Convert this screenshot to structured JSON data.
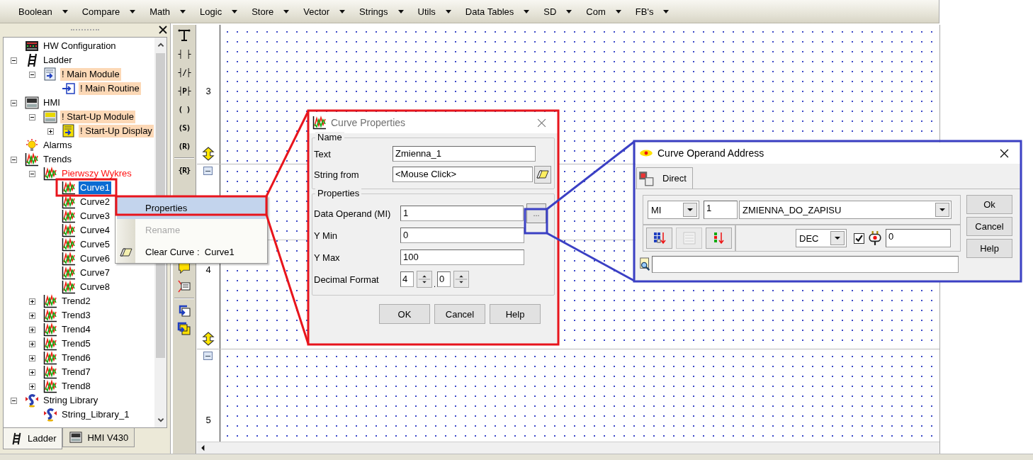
{
  "toolbar": {
    "menus": [
      {
        "label": "Boolean"
      },
      {
        "label": "Compare"
      },
      {
        "label": "Math"
      },
      {
        "label": "Logic"
      },
      {
        "label": "Store"
      },
      {
        "label": "Vector"
      },
      {
        "label": "Strings"
      },
      {
        "label": "Utils"
      },
      {
        "label": "Data Tables"
      },
      {
        "label": "SD"
      },
      {
        "label": "Com"
      },
      {
        "label": "FB's"
      }
    ]
  },
  "project_panel": {
    "tree": [
      {
        "label": "HW Configuration",
        "kind": "hw",
        "selected": false,
        "marked": false,
        "active": false
      },
      {
        "label": "Ladder",
        "kind": "ladder",
        "expanded": true,
        "selected": false,
        "marked": false,
        "active": false,
        "children": [
          {
            "label": "! Main Module",
            "kind": "module",
            "expanded": true,
            "selected": false,
            "marked": true,
            "active": false,
            "children": [
              {
                "label": "! Main Routine",
                "kind": "routine",
                "selected": false,
                "marked": true,
                "active": false
              }
            ]
          }
        ]
      },
      {
        "label": "HMI",
        "kind": "hmi",
        "expanded": true,
        "selected": false,
        "marked": false,
        "active": false,
        "children": [
          {
            "label": "! Start-Up Module",
            "kind": "hmi-module",
            "expanded": true,
            "selected": false,
            "marked": true,
            "active": false,
            "children": [
              {
                "label": "! Start-Up Display",
                "kind": "display",
                "expanded": false,
                "selected": false,
                "marked": true,
                "active": false
              }
            ]
          }
        ]
      },
      {
        "label": "Alarms",
        "kind": "alarm",
        "selected": false,
        "marked": false,
        "active": false
      },
      {
        "label": "Trends",
        "kind": "trend",
        "expanded": true,
        "selected": false,
        "marked": false,
        "active": false,
        "children": [
          {
            "label": "Pierwszy  Wykres",
            "kind": "trend",
            "expanded": true,
            "selected": false,
            "marked": false,
            "active": true,
            "children": [
              {
                "label": "Curve1",
                "kind": "trend",
                "selected": true,
                "marked": false,
                "active": false
              },
              {
                "label": "Curve2",
                "kind": "trend",
                "selected": false,
                "marked": false,
                "active": false
              },
              {
                "label": "Curve3",
                "kind": "trend",
                "selected": false,
                "marked": false,
                "active": false
              },
              {
                "label": "Curve4",
                "kind": "trend",
                "selected": false,
                "marked": false,
                "active": false
              },
              {
                "label": "Curve5",
                "kind": "trend",
                "selected": false,
                "marked": false,
                "active": false
              },
              {
                "label": "Curve6",
                "kind": "trend",
                "selected": false,
                "marked": false,
                "active": false
              },
              {
                "label": "Curve7",
                "kind": "trend",
                "selected": false,
                "marked": false,
                "active": false
              },
              {
                "label": "Curve8",
                "kind": "trend",
                "selected": false,
                "marked": false,
                "active": false
              }
            ]
          },
          {
            "label": "Trend2",
            "kind": "trend",
            "expanded": false,
            "selected": false,
            "marked": false,
            "active": false
          },
          {
            "label": "Trend3",
            "kind": "trend",
            "expanded": false,
            "selected": false,
            "marked": false,
            "active": false
          },
          {
            "label": "Trend4",
            "kind": "trend",
            "expanded": false,
            "selected": false,
            "marked": false,
            "active": false
          },
          {
            "label": "Trend5",
            "kind": "trend",
            "expanded": false,
            "selected": false,
            "marked": false,
            "active": false
          },
          {
            "label": "Trend6",
            "kind": "trend",
            "expanded": false,
            "selected": false,
            "marked": false,
            "active": false
          },
          {
            "label": "Trend7",
            "kind": "trend",
            "expanded": false,
            "selected": false,
            "marked": false,
            "active": false
          },
          {
            "label": "Trend8",
            "kind": "trend",
            "expanded": false,
            "selected": false,
            "marked": false,
            "active": false
          }
        ]
      },
      {
        "label": "String Library",
        "kind": "string",
        "expanded": true,
        "selected": false,
        "marked": false,
        "active": false,
        "children": [
          {
            "label": "String_Library_1",
            "kind": "string",
            "selected": false,
            "marked": false,
            "active": false
          }
        ]
      }
    ],
    "tabs": [
      {
        "label": "Ladder",
        "kind": "ladder",
        "selected": true
      },
      {
        "label": "HMI V430",
        "kind": "hmi",
        "selected": false
      }
    ]
  },
  "ladder_palette": [
    {
      "kind": "branch"
    },
    {
      "kind": "glyph",
      "label": "┤ ├"
    },
    {
      "kind": "glyph",
      "label": "┤/├"
    },
    {
      "kind": "glyph",
      "label": "┤P├"
    },
    {
      "kind": "glyph",
      "label": "( )"
    },
    {
      "kind": "glyph",
      "label": "(S)"
    },
    {
      "kind": "glyph",
      "label": "(R)"
    },
    {
      "kind": "separator"
    },
    {
      "kind": "glyph",
      "label": "{R}"
    },
    {
      "kind": "hidden"
    },
    {
      "kind": "comment"
    },
    {
      "kind": "list"
    },
    {
      "kind": "separator"
    },
    {
      "kind": "jump"
    },
    {
      "kind": "call"
    }
  ],
  "ladder": {
    "rungs": [
      {
        "number": "3"
      },
      {
        "number": "4"
      },
      {
        "number": "5"
      }
    ]
  },
  "context_menu": {
    "items": [
      {
        "label": "Properties",
        "kind": "plain",
        "selected": true,
        "disabled": false
      },
      {
        "label": "Rename",
        "kind": "plain",
        "selected": false,
        "disabled": true
      },
      {
        "label": "Clear Curve :  Curve1",
        "kind": "eraser",
        "selected": false,
        "disabled": false
      }
    ]
  },
  "curve_properties": {
    "title": "Curve Properties",
    "name_group": {
      "legend": "Name",
      "text": {
        "label": "Text",
        "value": "Zmienna_1"
      },
      "string_from": {
        "label": "String from",
        "value": "<Mouse Click>"
      }
    },
    "properties_group": {
      "legend": "Properties",
      "fields": [
        {
          "label": "Data Operand (MI)",
          "value": "1",
          "browse": "..."
        },
        {
          "label": "Y Min",
          "value": "0"
        },
        {
          "label": "Y Max",
          "value": "100"
        }
      ],
      "decimal_format": {
        "label": "Decimal Format",
        "integer": "4",
        "separator": ".",
        "fraction": "0"
      }
    },
    "buttons": [
      "OK",
      "Cancel",
      "Help"
    ]
  },
  "operand_address": {
    "title": "Curve Operand Address",
    "tabs": [
      {
        "label": "Direct",
        "selected": true
      }
    ],
    "type": "MI",
    "address": "1",
    "name": "ZMIENNA_DO_ZAPISU",
    "tools": [
      {
        "kind": "grid",
        "disabled": false
      },
      {
        "kind": "keypad",
        "disabled": true
      },
      {
        "kind": "list",
        "disabled": false
      }
    ],
    "format": "DEC",
    "checked": true,
    "value": "0",
    "buttons": [
      "Ok",
      "Cancel",
      "Help"
    ]
  }
}
